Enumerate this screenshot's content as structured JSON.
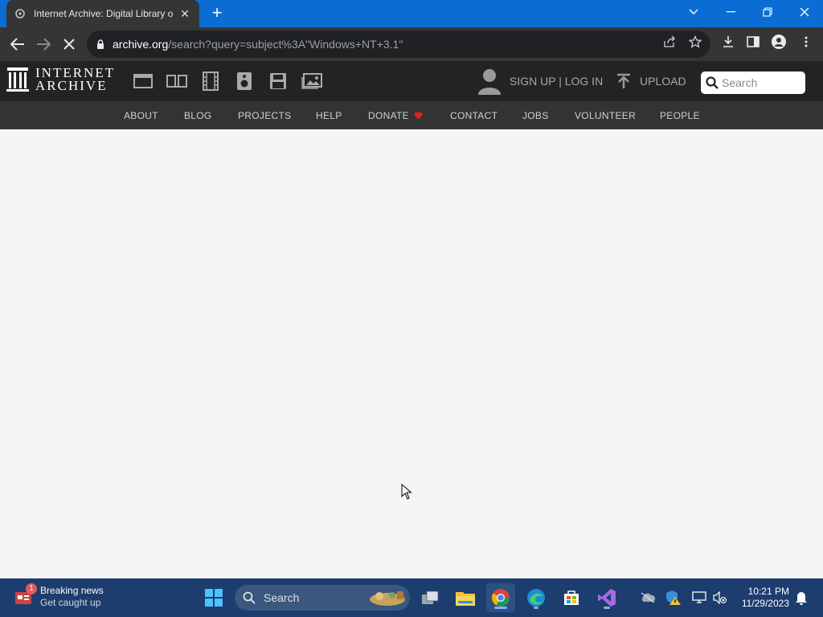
{
  "browser": {
    "tab_title": "Internet Archive: Digital Library o",
    "tab_close": "✕",
    "new_tab": "+",
    "url_host": "archive.org",
    "url_path": "/search?query=subject%3A\"Windows+NT+3.1\""
  },
  "site": {
    "logo_line1": "INTERNET",
    "logo_line2": "ARCHIVE",
    "media_icons": [
      "web-icon",
      "texts-icon",
      "video-icon",
      "audio-icon",
      "software-icon",
      "images-icon"
    ],
    "signup_login": "SIGN UP | LOG IN",
    "upload": "UPLOAD",
    "search_placeholder": "Search",
    "nav": [
      "ABOUT",
      "BLOG",
      "PROJECTS",
      "HELP",
      "DONATE",
      "CONTACT",
      "JOBS",
      "VOLUNTEER",
      "PEOPLE"
    ],
    "donate_heart_color": "#e02020"
  },
  "taskbar": {
    "news_title": "Breaking news",
    "news_sub": "Get caught up",
    "news_badge": "1",
    "search_label": "Search",
    "time": "10:21 PM",
    "date": "11/29/2023"
  },
  "colors": {
    "tabstrip": "#0b6dd4",
    "chrome_dark": "#353535",
    "ia_top": "#232323",
    "ia_sub": "#333333",
    "taskbar": "#1c3d6e",
    "progress": "#3b7fd9"
  }
}
